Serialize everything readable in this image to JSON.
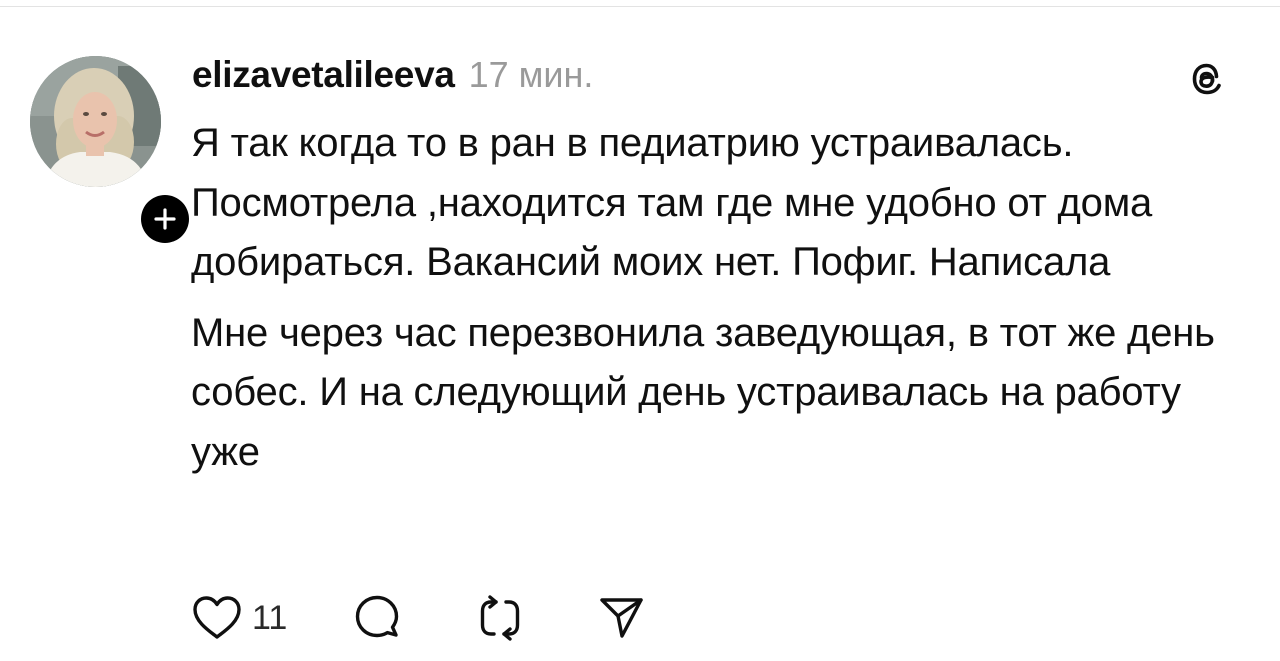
{
  "post": {
    "author": "elizavetalileeva",
    "time_ago": "17 мин.",
    "paragraphs": [
      "Я так когда то в ран в педиатрию устраивалась. Посмотрела ,находится там где мне удобно от дома добираться. Вакансий моих нет. Пофиг. Написала",
      "Мне через час перезвонила заведующая, в тот же день собес. И на следующий день устраивалась на работу уже"
    ],
    "likes_count": "11"
  },
  "icons": {
    "follow": "plus-icon",
    "brand": "threads-logo-icon",
    "like": "heart-icon",
    "comment": "speech-bubble-icon",
    "repost": "repost-icon",
    "share": "paper-plane-icon"
  },
  "colors": {
    "text": "#101010",
    "secondary_text": "#9a9a9a",
    "background": "#ffffff"
  }
}
